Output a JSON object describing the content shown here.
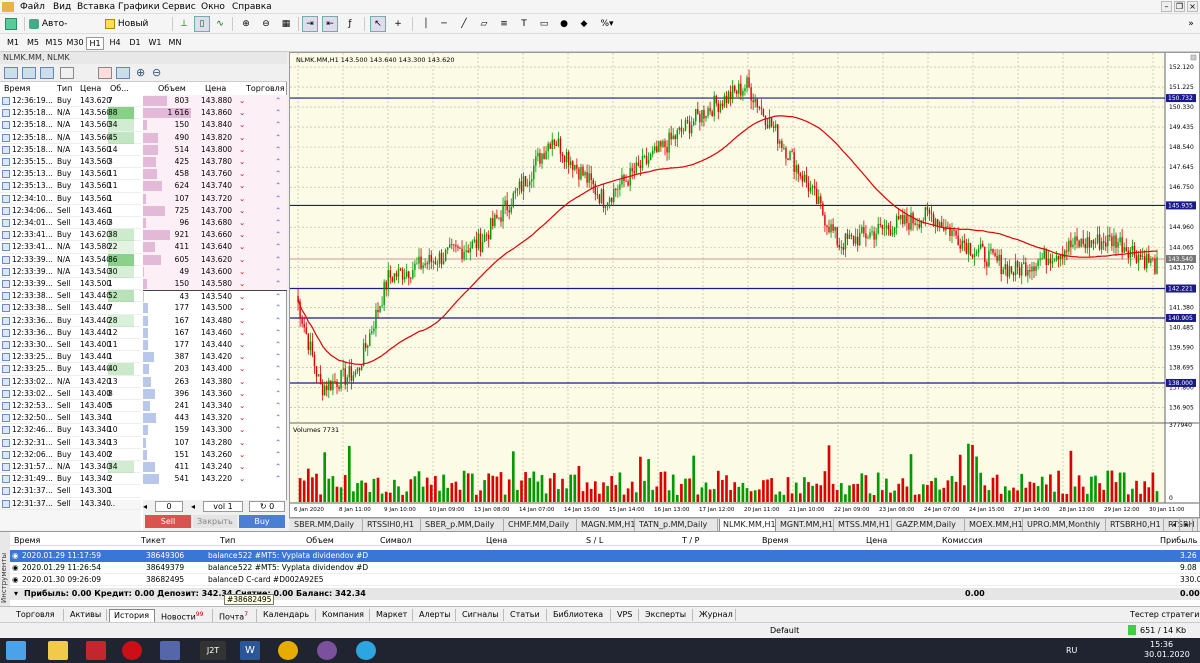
{
  "menu": [
    "Файл",
    "Вид",
    "Вставка",
    "Графики",
    "Сервис",
    "Окно",
    "Справка"
  ],
  "toolbar": {
    "autotrade": "Авто-торговля",
    "neworder": "Новый ордер"
  },
  "timeframes": [
    "M1",
    "M5",
    "M15",
    "M30",
    "H1",
    "H4",
    "D1",
    "W1",
    "MN"
  ],
  "active_timeframe": "H1",
  "depth": {
    "title": "NLMK.MM, NLMK",
    "trade_headers": [
      "Время",
      "Тип",
      "Цена",
      "Об..."
    ],
    "book_headers": [
      "Объем",
      "Цена",
      "Торговля"
    ],
    "trades": [
      [
        "12:36:19...",
        "Buy",
        "143.620",
        "7"
      ],
      [
        "12:35:18...",
        "N/A",
        "143.560",
        "88"
      ],
      [
        "12:35:18...",
        "N/A",
        "143.560",
        "34"
      ],
      [
        "12:35:18...",
        "N/A",
        "143.560",
        "45"
      ],
      [
        "12:35:18...",
        "N/A",
        "143.560",
        "14"
      ],
      [
        "12:35:15...",
        "Buy",
        "143.560",
        "3"
      ],
      [
        "12:35:13...",
        "Buy",
        "143.560",
        "11"
      ],
      [
        "12:35:13...",
        "Buy",
        "143.560",
        "11"
      ],
      [
        "12:34:10...",
        "Buy",
        "143.560",
        "1"
      ],
      [
        "12:34:06...",
        "Sell",
        "143.460",
        "1"
      ],
      [
        "12:34:01...",
        "Sell",
        "143.460",
        "3"
      ],
      [
        "12:33:41...",
        "Buy",
        "143.620",
        "38"
      ],
      [
        "12:33:41...",
        "N/A",
        "143.580",
        "22"
      ],
      [
        "12:33:39...",
        "N/A",
        "143.540",
        "86"
      ],
      [
        "12:33:39...",
        "N/A",
        "143.540",
        "30"
      ],
      [
        "12:33:39...",
        "Sell",
        "143.500",
        "1"
      ],
      [
        "12:33:38...",
        "Sell",
        "143.440",
        "52"
      ],
      [
        "12:33:38...",
        "Sell",
        "143.440",
        "7"
      ],
      [
        "12:33:36...",
        "Buy",
        "143.440",
        "28"
      ],
      [
        "12:33:36...",
        "Buy",
        "143.440",
        "12"
      ],
      [
        "12:33:30...",
        "Sell",
        "143.400",
        "11"
      ],
      [
        "12:33:25...",
        "Buy",
        "143.440",
        "1"
      ],
      [
        "12:33:25...",
        "Buy",
        "143.440",
        "40"
      ],
      [
        "12:33:02...",
        "N/A",
        "143.420",
        "13"
      ],
      [
        "12:33:02...",
        "Sell",
        "143.400",
        "8"
      ],
      [
        "12:32:53...",
        "Sell",
        "143.400",
        "5"
      ],
      [
        "12:32:50...",
        "Sell",
        "143.340",
        "1"
      ],
      [
        "12:32:46...",
        "Buy",
        "143.340",
        "10"
      ],
      [
        "12:32:31...",
        "Sell",
        "143.340",
        "13"
      ],
      [
        "12:32:06...",
        "Buy",
        "143.400",
        "2"
      ],
      [
        "12:31:57...",
        "N/A",
        "143.340",
        "34"
      ],
      [
        "12:31:49...",
        "Buy",
        "143.340",
        "2"
      ],
      [
        "12:31:37...",
        "Sell",
        "143.300",
        "1"
      ],
      [
        "12:31:37...",
        "Sell",
        "143.340",
        "..."
      ]
    ],
    "asks": [
      [
        "803",
        "143.880"
      ],
      [
        "1 616",
        "143.860"
      ],
      [
        "150",
        "143.840"
      ],
      [
        "490",
        "143.820"
      ],
      [
        "514",
        "143.800"
      ],
      [
        "425",
        "143.780"
      ],
      [
        "458",
        "143.760"
      ],
      [
        "624",
        "143.740"
      ],
      [
        "107",
        "143.720"
      ],
      [
        "725",
        "143.700"
      ],
      [
        "96",
        "143.680"
      ],
      [
        "921",
        "143.660"
      ],
      [
        "411",
        "143.640"
      ],
      [
        "605",
        "143.620"
      ],
      [
        "49",
        "143.600"
      ],
      [
        "150",
        "143.580"
      ]
    ],
    "bids": [
      [
        "43",
        "143.540"
      ],
      [
        "177",
        "143.500"
      ],
      [
        "167",
        "143.480"
      ],
      [
        "167",
        "143.460"
      ],
      [
        "177",
        "143.440"
      ],
      [
        "387",
        "143.420"
      ],
      [
        "203",
        "143.400"
      ],
      [
        "263",
        "143.380"
      ],
      [
        "396",
        "143.360"
      ],
      [
        "241",
        "143.340"
      ],
      [
        "443",
        "143.320"
      ],
      [
        "159",
        "143.300"
      ],
      [
        "107",
        "143.280"
      ],
      [
        "151",
        "143.260"
      ],
      [
        "411",
        "143.240"
      ],
      [
        "541",
        "143.220"
      ]
    ],
    "lot_value": "0",
    "vol_value": "1",
    "sl_value": "0",
    "sell": "Sell",
    "close": "Закрыть",
    "buy": "Buy"
  },
  "chart": {
    "title": "NLMK.MM,H1  143.500 143.640 143.300 143.620",
    "price_labels": [
      "152.120",
      "151.225",
      "150.732",
      "150.330",
      "149.435",
      "148.540",
      "147.645",
      "146.750",
      "145.935",
      "144.960",
      "144.065",
      "143.540",
      "143.170",
      "142.221",
      "141.380",
      "140.905",
      "140.485",
      "139.590",
      "138.695",
      "138.000",
      "137.800",
      "136.905"
    ],
    "hlines": [
      {
        "price": 150.732,
        "label": "150.732"
      },
      {
        "price": 145.935,
        "label": "145.935"
      },
      {
        "price": 143.54,
        "label": "143.540"
      },
      {
        "price": 142.221,
        "label": "142.221"
      },
      {
        "price": 140.905,
        "label": "140.905"
      },
      {
        "price": 138.0,
        "label": "138.000"
      }
    ],
    "date_labels": [
      "6 Jan 2020",
      "8 Jan 11:00",
      "9 Jan 10:00",
      "10 Jan 09:00",
      "13 Jan 08:00",
      "14 Jan 07:00",
      "14 Jan 15:00",
      "15 Jan 14:00",
      "16 Jan 13:00",
      "17 Jan 12:00",
      "20 Jan 11:00",
      "21 Jan 10:00",
      "22 Jan 09:00",
      "23 Jan 08:00",
      "24 Jan 07:00",
      "24 Jan 15:00",
      "27 Jan 14:00",
      "28 Jan 13:00",
      "29 Jan 12:00",
      "30 Jan 11:00"
    ],
    "volumes_label": "Volumes 7731",
    "vol_scale_top": "377940",
    "vol_scale_bottom": "0",
    "colors": {
      "bg": "#fbfbe6",
      "up": "#009900",
      "down": "#dd0000",
      "ma": "#e00000",
      "hline": "#1a1a8a"
    }
  },
  "symbol_tabs": [
    "SBER.MM,Daily",
    "RTSSIH0,H1",
    "SBER_p.MM,Daily",
    "CHMF.MM,Daily",
    "MAGN.MM,H1",
    "TATN_p.MM,Daily",
    "NLMK.MM,H1",
    "MGNT.MM,H1",
    "MTSS.MM,H1",
    "GAZP.MM,Daily",
    "MOEX.MM,H1",
    "UPRO.MM,Monthly",
    "RTSBRH0,H1",
    "RTSRH"
  ],
  "active_symbol_tab": "NLMK.MM,H1",
  "terminal": {
    "side": "Инструменты",
    "headers": [
      "Время",
      "Тикет",
      "Тип",
      "Объем",
      "Символ",
      "Цена",
      "S / L",
      "T / P",
      "Время",
      "Цена",
      "Комиссия",
      "Прибыль"
    ],
    "rows": [
      {
        "time": "2020.01.29 11:17:59",
        "ticket": "38649306",
        "type": "balance",
        "comment": "522 #MT5: Vyplata dividendov #D",
        "profit": "3.26"
      },
      {
        "time": "2020.01.29 11:26:54",
        "ticket": "38649379",
        "type": "balance",
        "comment": "522 #MT5: Vyplata dividendov #D",
        "profit": "9.08"
      },
      {
        "time": "2020.01.30 09:26:09",
        "ticket": "38682495",
        "type": "balance",
        "comment": "D C-card #D002A92E5",
        "profit": "330.00"
      }
    ],
    "summary": "Прибыль: 0.00  Кредит: 0.00  Депозит: 342.34  Снятие: 0.00  Баланс: 342.34",
    "summary_commission": "0.00",
    "summary_profit": "0.00",
    "tooltip": "#38682495",
    "tabs": [
      "Торговля",
      "Активы",
      "История",
      "Новости",
      "Почта",
      "Календарь",
      "Компания",
      "Маркет",
      "Алерты",
      "Сигналы",
      "Статьи",
      "Библиотека",
      "VPS",
      "Эксперты",
      "Журнал"
    ],
    "news_count": "99",
    "mail_count": "7",
    "active_tab": "История",
    "tester": "Тестер стратегий"
  },
  "status": {
    "profile": "Default",
    "traffic": "651 / 14 Kb"
  },
  "taskbar": {
    "lang": "RU",
    "time": "15:36",
    "date": "30.01.2020"
  }
}
